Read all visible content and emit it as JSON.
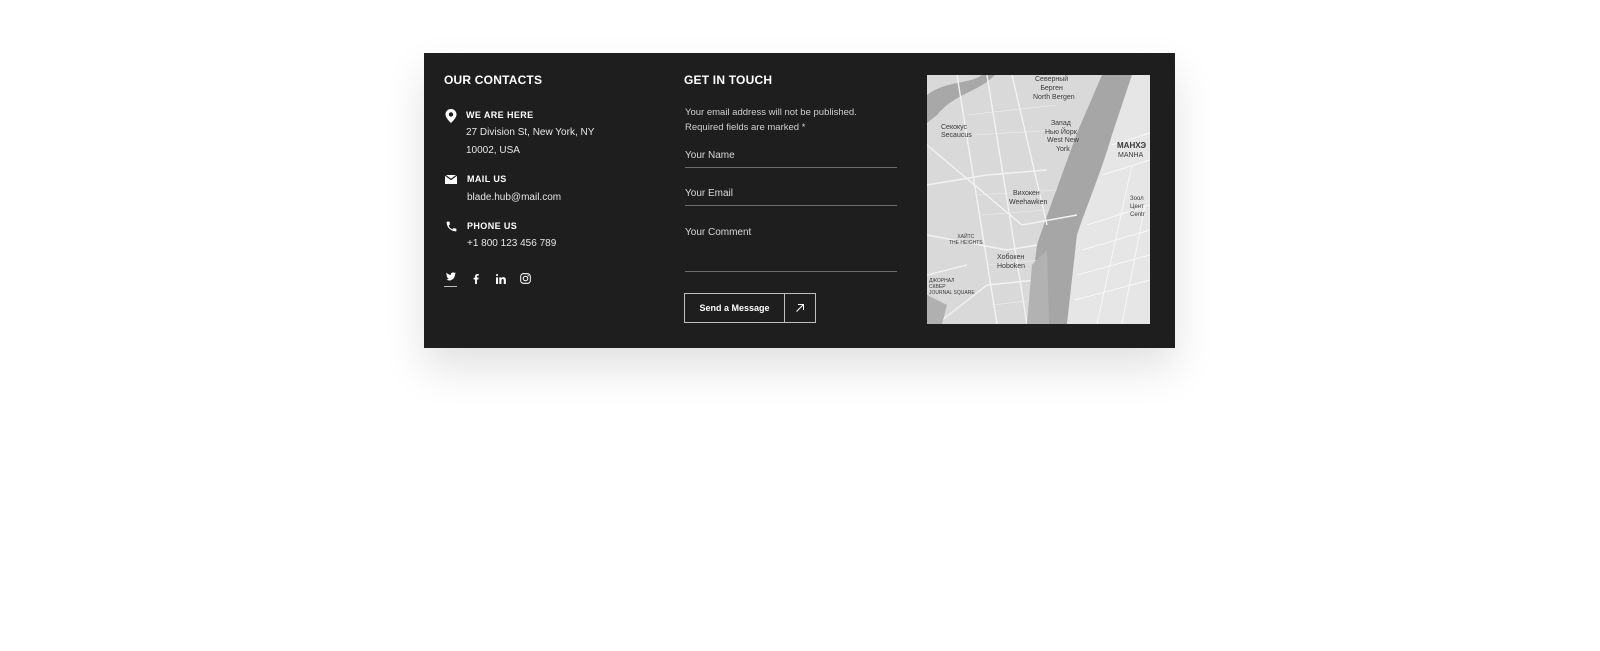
{
  "contacts": {
    "title": "OUR CONTACTS",
    "address": {
      "icon": "map-pin-icon",
      "label": "WE ARE HERE",
      "line1": "27 Division St, New York, NY",
      "line2": "10002, USA"
    },
    "mail": {
      "icon": "envelope-icon",
      "label": "MAIL US",
      "value": "blade.hub@mail.com"
    },
    "phone": {
      "icon": "phone-icon",
      "label": "PHONE US",
      "value": "+1 800 123 456 789"
    },
    "socials": [
      "twitter-icon",
      "facebook-icon",
      "linkedin-icon",
      "instagram-icon"
    ]
  },
  "form": {
    "title": "GET IN TOUCH",
    "note": "Your email address will not be published. Required fields are marked *",
    "name_placeholder": "Your Name",
    "email_placeholder": "Your Email",
    "comment_placeholder": "Your Comment",
    "send_label": "Send a Message",
    "send_icon": "arrow-up-right-icon"
  },
  "map": {
    "labels": {
      "north_bergen_ru": "Северный\nБерген",
      "north_bergen": "North Bergen",
      "secaucus_ru": "Секокус",
      "secaucus": "Secaucus",
      "west_ny_ru": "Запад\nНью Йорк",
      "west_ny": "West New\nYork",
      "manhattan_ru": "МАНХЭ",
      "manhattan": "MANHA",
      "weehawken_ru": "Вихокен",
      "weehawken": "Weehawken",
      "heights": "ХАЙТС\nTHE HEIGHTS",
      "hoboken_ru": "Хобокен",
      "hoboken": "Hoboken",
      "journal_sq": "ДЖОРНАЛ\nСКВЕР\nJOURNAL SQUARE",
      "zoo_ru": "Зоол\nЦент\nCentr"
    },
    "colors": {
      "land": "#d6d6d6",
      "water": "#a6a6a6",
      "roads": "#f2f2f2"
    }
  }
}
